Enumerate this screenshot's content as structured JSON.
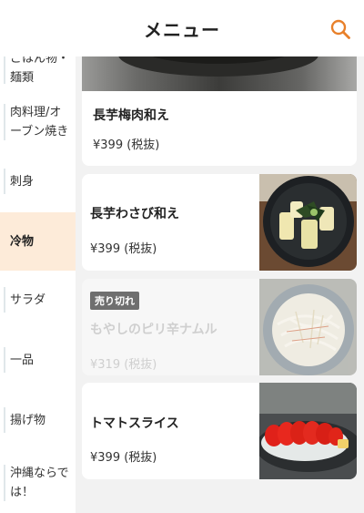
{
  "header": {
    "title": "メニュー",
    "search_icon": "search-icon"
  },
  "sidebar": {
    "items": [
      {
        "label": "ごはん物・\n麺類",
        "active": false
      },
      {
        "label": "肉料理/オ\nーブン焼き",
        "active": false
      },
      {
        "label": "刺身",
        "active": false
      },
      {
        "label": "冷物",
        "active": true
      },
      {
        "label": "サラダ",
        "active": false
      },
      {
        "label": "一品",
        "active": false
      },
      {
        "label": "揚げ物",
        "active": false
      },
      {
        "label": "沖縄ならで\nは！",
        "active": false
      }
    ]
  },
  "menu": {
    "items": [
      {
        "name": "長芋梅肉和え",
        "price": "¥399 (税抜)"
      },
      {
        "name": "長芋わさび和え",
        "price": "¥399 (税抜)"
      },
      {
        "name": "もやしのピリ辛ナムル",
        "price": "¥319 (税抜)",
        "badge": "売り切れ"
      },
      {
        "name": "トマトスライス",
        "price": "¥399 (税抜)"
      }
    ]
  },
  "colors": {
    "accent": "#e8802a",
    "active_bg": "#fdebd9",
    "soldout_badge": "#6f6f6f"
  }
}
